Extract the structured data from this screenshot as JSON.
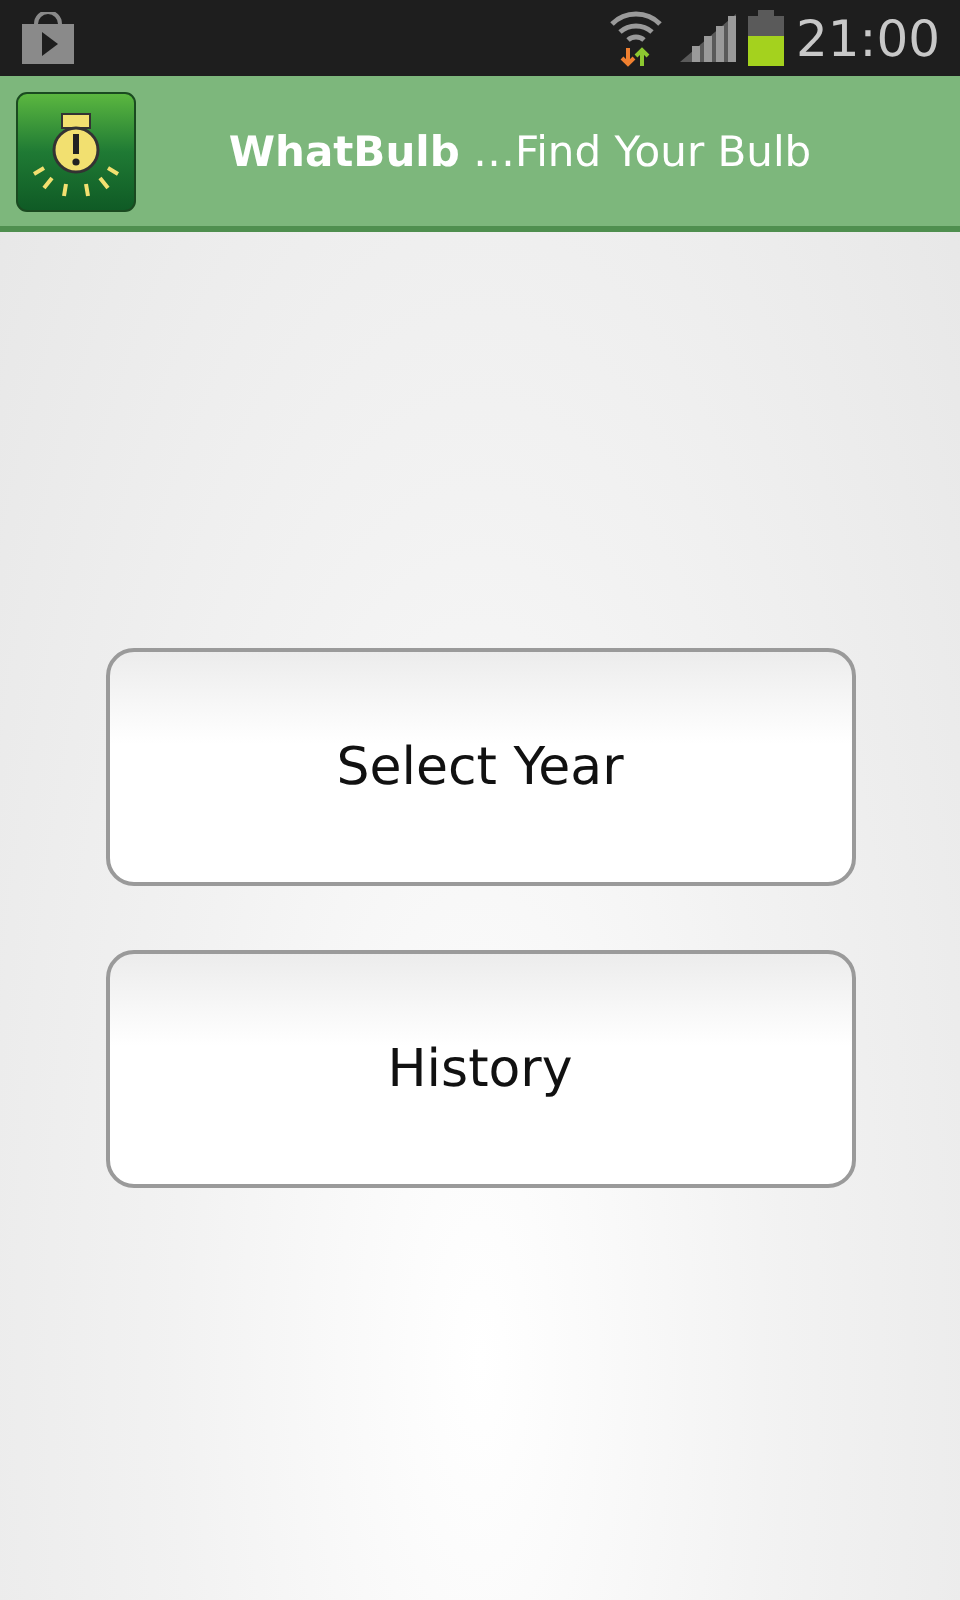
{
  "status_bar": {
    "time": "21:00"
  },
  "app_bar": {
    "title": "**WhatBulb** …Find Your Bulb"
  },
  "buttons": [
    {
      "label": "Select Year"
    },
    {
      "label": "History"
    }
  ]
}
